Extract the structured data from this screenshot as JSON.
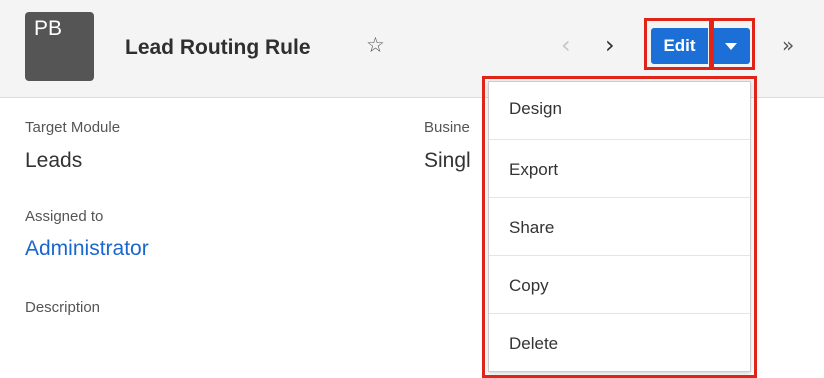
{
  "header": {
    "avatar_initials": "PB",
    "title": "Lead Routing Rule",
    "favorite_icon": "star-outline-icon",
    "prev_glyph": "‹",
    "next_glyph": "›",
    "edit_label": "Edit",
    "more_glyph": "»"
  },
  "fields": [
    {
      "label": "Target Module",
      "value": "Leads"
    },
    {
      "label": "Busine",
      "value": "Singl"
    },
    {
      "label": "Assigned to",
      "value": "Administrator"
    },
    {
      "label": "Description",
      "value": ""
    }
  ],
  "actions_menu": {
    "items": [
      {
        "label": "Design"
      },
      {
        "label": "Export"
      },
      {
        "label": "Share"
      },
      {
        "label": "Copy"
      },
      {
        "label": "Delete"
      }
    ]
  },
  "colors": {
    "primary_button": "#1b6fd6",
    "highlight": "#e02418",
    "link": "#1a66d1"
  }
}
